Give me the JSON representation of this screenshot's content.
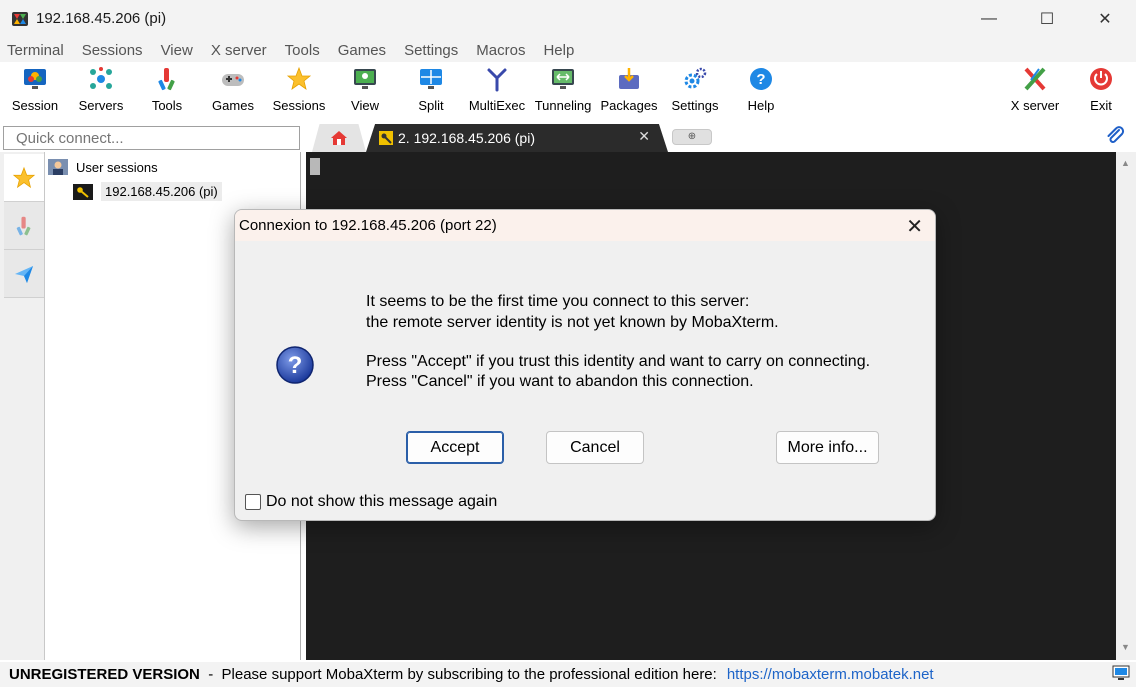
{
  "window": {
    "title": "192.168.45.206 (pi)",
    "minimize_icon": "minimize-icon",
    "maximize_icon": "maximize-icon",
    "close_icon": "close-icon",
    "minimize_glyph": "—",
    "maximize_glyph": "☐",
    "close_glyph": "✕"
  },
  "menu": [
    "Terminal",
    "Sessions",
    "View",
    "X server",
    "Tools",
    "Games",
    "Settings",
    "Macros",
    "Help"
  ],
  "toolbar": {
    "left": [
      {
        "label": "Session",
        "icon": "session-icon"
      },
      {
        "label": "Servers",
        "icon": "servers-icon"
      },
      {
        "label": "Tools",
        "icon": "tools-icon"
      },
      {
        "label": "Games",
        "icon": "games-icon"
      },
      {
        "label": "Sessions",
        "icon": "star-icon"
      },
      {
        "label": "View",
        "icon": "view-icon"
      },
      {
        "label": "Split",
        "icon": "split-icon"
      },
      {
        "label": "MultiExec",
        "icon": "multiexec-icon"
      },
      {
        "label": "Tunneling",
        "icon": "tunneling-icon"
      },
      {
        "label": "Packages",
        "icon": "packages-icon"
      },
      {
        "label": "Settings",
        "icon": "gear-icon"
      },
      {
        "label": "Help",
        "icon": "help-icon"
      }
    ],
    "right": [
      {
        "label": "X server",
        "icon": "x-server-icon"
      },
      {
        "label": "Exit",
        "icon": "power-icon"
      }
    ]
  },
  "quick_connect": {
    "placeholder": "Quick connect..."
  },
  "tabs": {
    "home_icon": "home-icon",
    "active_label": "2. 192.168.45.206 (pi)",
    "close_glyph": "✕",
    "new_tab_glyph": "⊕"
  },
  "sidebar": {
    "tabs": [
      "star-icon",
      "tools-icon",
      "send-icon"
    ],
    "tree": {
      "root_label": "User sessions",
      "session_label": "192.168.45.206 (pi)"
    }
  },
  "dialog": {
    "title": "Connexion to 192.168.45.206 (port 22)",
    "close_glyph": "✕",
    "line1": "It seems to be the first time you connect to this server:",
    "line2": "the remote server identity is not yet known by MobaXterm.",
    "line3": "Press \"Accept\" if you trust this identity and want to carry on connecting.",
    "line4": "Press \"Cancel\" if you want to abandon this connection.",
    "accept_label": "Accept",
    "cancel_label": "Cancel",
    "more_info_label": "More info...",
    "checkbox_label": "Do not show this message again",
    "checkbox_checked": false
  },
  "statusbar": {
    "version": "UNREGISTERED VERSION",
    "message": "  -  Please support MobaXterm by subscribing to the professional edition here:",
    "link": "https://mobaxterm.mobatek.net"
  },
  "colors": {
    "accent_blue": "#2a5ea8",
    "terminal_bg": "#1e1e1e",
    "link": "#1d64c8",
    "exit_red": "#e53935"
  }
}
